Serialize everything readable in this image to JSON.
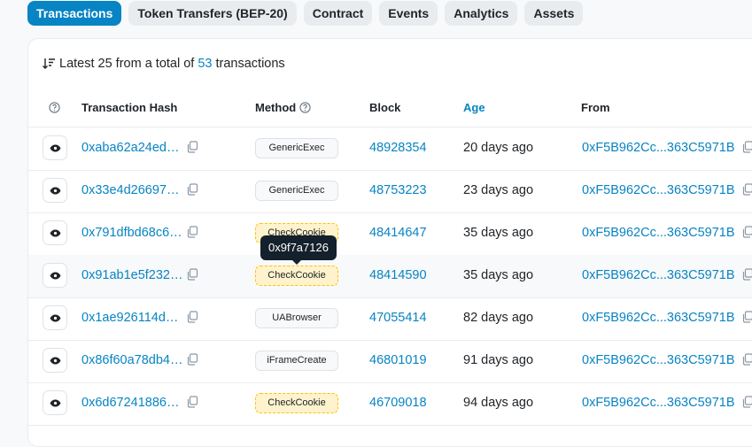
{
  "tabs": [
    {
      "label": "Transactions"
    },
    {
      "label": "Token Transfers (BEP-20)"
    },
    {
      "label": "Contract"
    },
    {
      "label": "Events"
    },
    {
      "label": "Analytics"
    },
    {
      "label": "Assets"
    }
  ],
  "summary": {
    "prefix": "Latest 25 from a total of",
    "count": "53",
    "suffix": "transactions"
  },
  "columns": {
    "hash": "Transaction Hash",
    "method": "Method",
    "block": "Block",
    "age": "Age",
    "from": "From"
  },
  "rows": [
    {
      "hash": "0xaba62a24ed…",
      "method": "GenericExec",
      "block": "48928354",
      "age": "20 days ago",
      "from": "0xF5B962Cc...363C5971B"
    },
    {
      "hash": "0x33e4d26697…",
      "method": "GenericExec",
      "block": "48753223",
      "age": "23 days ago",
      "from": "0xF5B962Cc...363C5971B"
    },
    {
      "hash": "0x791dfbd68c6…",
      "method": "CheckCookie",
      "block": "48414647",
      "age": "35 days ago",
      "from": "0xF5B962Cc...363C5971B"
    },
    {
      "hash": "0x91ab1e5f232…",
      "method": "CheckCookie",
      "block": "48414590",
      "age": "35 days ago",
      "from": "0xF5B962Cc...363C5971B"
    },
    {
      "hash": "0x1ae926114d…",
      "method": "UABrowser",
      "block": "47055414",
      "age": "82 days ago",
      "from": "0xF5B962Cc...363C5971B"
    },
    {
      "hash": "0x86f60a78db4…",
      "method": "iFrameCreate",
      "block": "46801019",
      "age": "91 days ago",
      "from": "0xF5B962Cc...363C5971B"
    },
    {
      "hash": "0x6d67241886…",
      "method": "CheckCookie",
      "block": "46709018",
      "age": "94 days ago",
      "from": "0xF5B962Cc...363C5971B"
    }
  ],
  "tooltip": {
    "text": "0x9f7a7126"
  },
  "colors": {
    "accent": "#0784c3",
    "warning_bg": "#fff3cd",
    "tooltip_bg": "#14202b"
  }
}
